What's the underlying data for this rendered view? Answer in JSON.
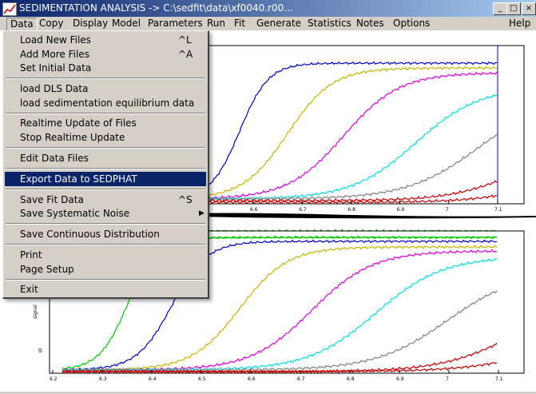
{
  "window": {
    "title": "SEDIMENTATION ANALYSIS -> C:\\sedfit\\data\\xf0040.r00...",
    "minimize_glyph": "_",
    "maximize_glyph": "□",
    "close_glyph": "×"
  },
  "menubar": {
    "items": [
      "Data",
      "Copy",
      "Display",
      "Model",
      "Parameters",
      "Run",
      "Fit",
      "Generate",
      "Statistics",
      "Notes",
      "Options",
      "Help"
    ],
    "active": "Data"
  },
  "data_menu": {
    "items": [
      {
        "label": "Load New Files",
        "shortcut": "^L"
      },
      {
        "label": "Add More Files",
        "shortcut": "^A"
      },
      {
        "label": "Set Initial Data",
        "shortcut": ""
      },
      {
        "label": "load DLS Data",
        "shortcut": ""
      },
      {
        "label": "load sedimentation equilibrium data",
        "shortcut": ""
      },
      {
        "label": "Realtime Update of Files",
        "shortcut": ""
      },
      {
        "label": "Stop Realtime Update",
        "shortcut": ""
      },
      {
        "label": "Edit Data Files",
        "shortcut": ""
      },
      {
        "label": "Export Data to SEDPHAT",
        "shortcut": "",
        "highlighted": true
      },
      {
        "label": "Save Fit Data",
        "shortcut": "^S"
      },
      {
        "label": "Save Systematic Noise",
        "shortcut": "",
        "submenu": true
      },
      {
        "label": "Save Continuous Distribution",
        "shortcut": ""
      },
      {
        "label": "Print",
        "shortcut": ""
      },
      {
        "label": "Page Setup",
        "shortcut": ""
      },
      {
        "label": "Exit",
        "shortcut": ""
      }
    ],
    "submenu_glyph": "▶"
  },
  "plots": {
    "top_x_ticks": [
      "6.6",
      "6.7",
      "6.8",
      "6.9",
      "7",
      "7.1"
    ],
    "bottom_x_ticks": [
      "6.2",
      "6.3",
      "6.4",
      "6.5",
      "6.6",
      "6.7",
      "6.8",
      "6.9",
      "7",
      "7.1"
    ],
    "bottom_y_tick": "0",
    "bottom_y_label": "signal",
    "series_colors": [
      "#00cc00",
      "#0000c8",
      "#c8b400",
      "#e000e0",
      "#00e0e0",
      "#808080",
      "#c80000"
    ]
  }
}
